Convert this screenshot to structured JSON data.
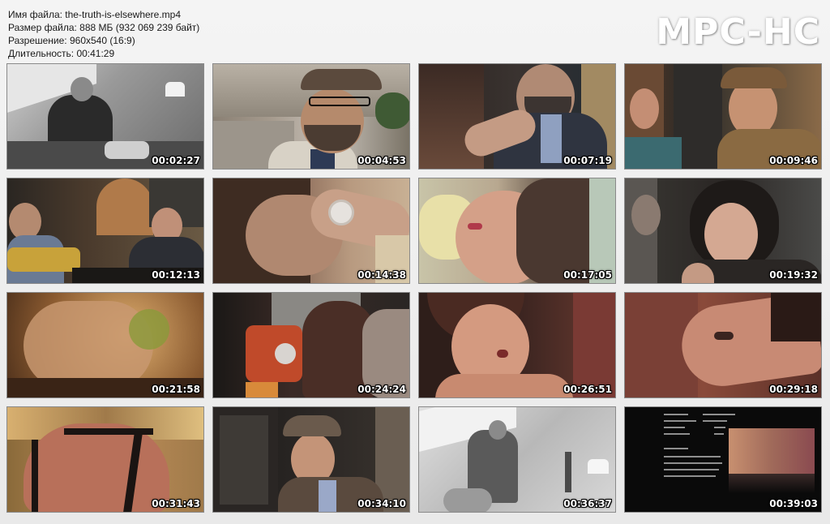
{
  "file_info": {
    "name": "Имя файла: the-truth-is-elsewhere.mp4",
    "size": "Размер файла: 888 МБ (932 069 239 байт)",
    "resolution": "Разрешение: 960x540 (16:9)",
    "duration": "Длительность: 00:41:29"
  },
  "logo": "MPC-HC",
  "thumbnails": [
    {
      "time": "00:02:27",
      "scene": "office-bw"
    },
    {
      "time": "00:04:53",
      "scene": "man-hat-street"
    },
    {
      "time": "00:07:19",
      "scene": "tie-grab"
    },
    {
      "time": "00:09:46",
      "scene": "bar-man-cap"
    },
    {
      "time": "00:12:13",
      "scene": "bar-counter"
    },
    {
      "time": "00:14:38",
      "scene": "watch-wrist"
    },
    {
      "time": "00:17:05",
      "scene": "woman-closeup"
    },
    {
      "time": "00:19:32",
      "scene": "woman-dark-hair"
    },
    {
      "time": "00:21:58",
      "scene": "hand-blur"
    },
    {
      "time": "00:24:24",
      "scene": "espresso-machine"
    },
    {
      "time": "00:26:51",
      "scene": "woman-crying"
    },
    {
      "time": "00:29:18",
      "scene": "face-sideways"
    },
    {
      "time": "00:31:43",
      "scene": "back-lights"
    },
    {
      "time": "00:34:10",
      "scene": "man-hat-looking-down"
    },
    {
      "time": "00:36:37",
      "scene": "bw-window"
    },
    {
      "time": "00:39:03",
      "scene": "credits"
    }
  ]
}
